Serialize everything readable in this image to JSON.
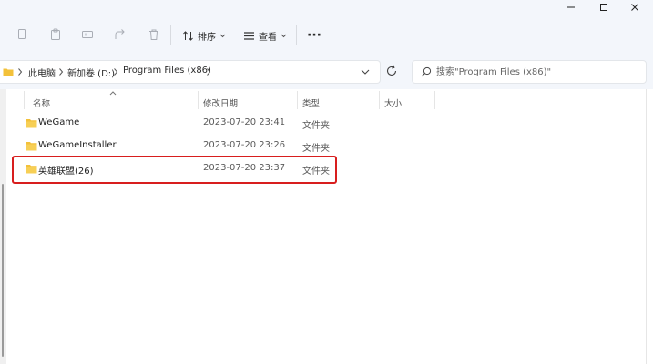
{
  "toolbar": {
    "sort_label": "排序",
    "view_label": "查看",
    "more_label": "···"
  },
  "address": {
    "crumbs": [
      "此电脑",
      "新加卷 (D:)",
      "Program Files (x86)"
    ]
  },
  "search": {
    "placeholder": "搜索\"Program Files (x86)\""
  },
  "columns": {
    "name": "名称",
    "date": "修改日期",
    "type": "类型",
    "size": "大小"
  },
  "files": [
    {
      "name": "WeGame",
      "date": "2023-07-20 23:41",
      "type": "文件夹"
    },
    {
      "name": "WeGameInstaller",
      "date": "2023-07-20 23:26",
      "type": "文件夹"
    },
    {
      "name": "英雄联盟(26)",
      "date": "2023-07-20 23:37",
      "type": "文件夹"
    }
  ],
  "colors": {
    "folder": "#f3c13a",
    "highlight": "#d81e1e",
    "chrome": "#f3f6fb"
  }
}
